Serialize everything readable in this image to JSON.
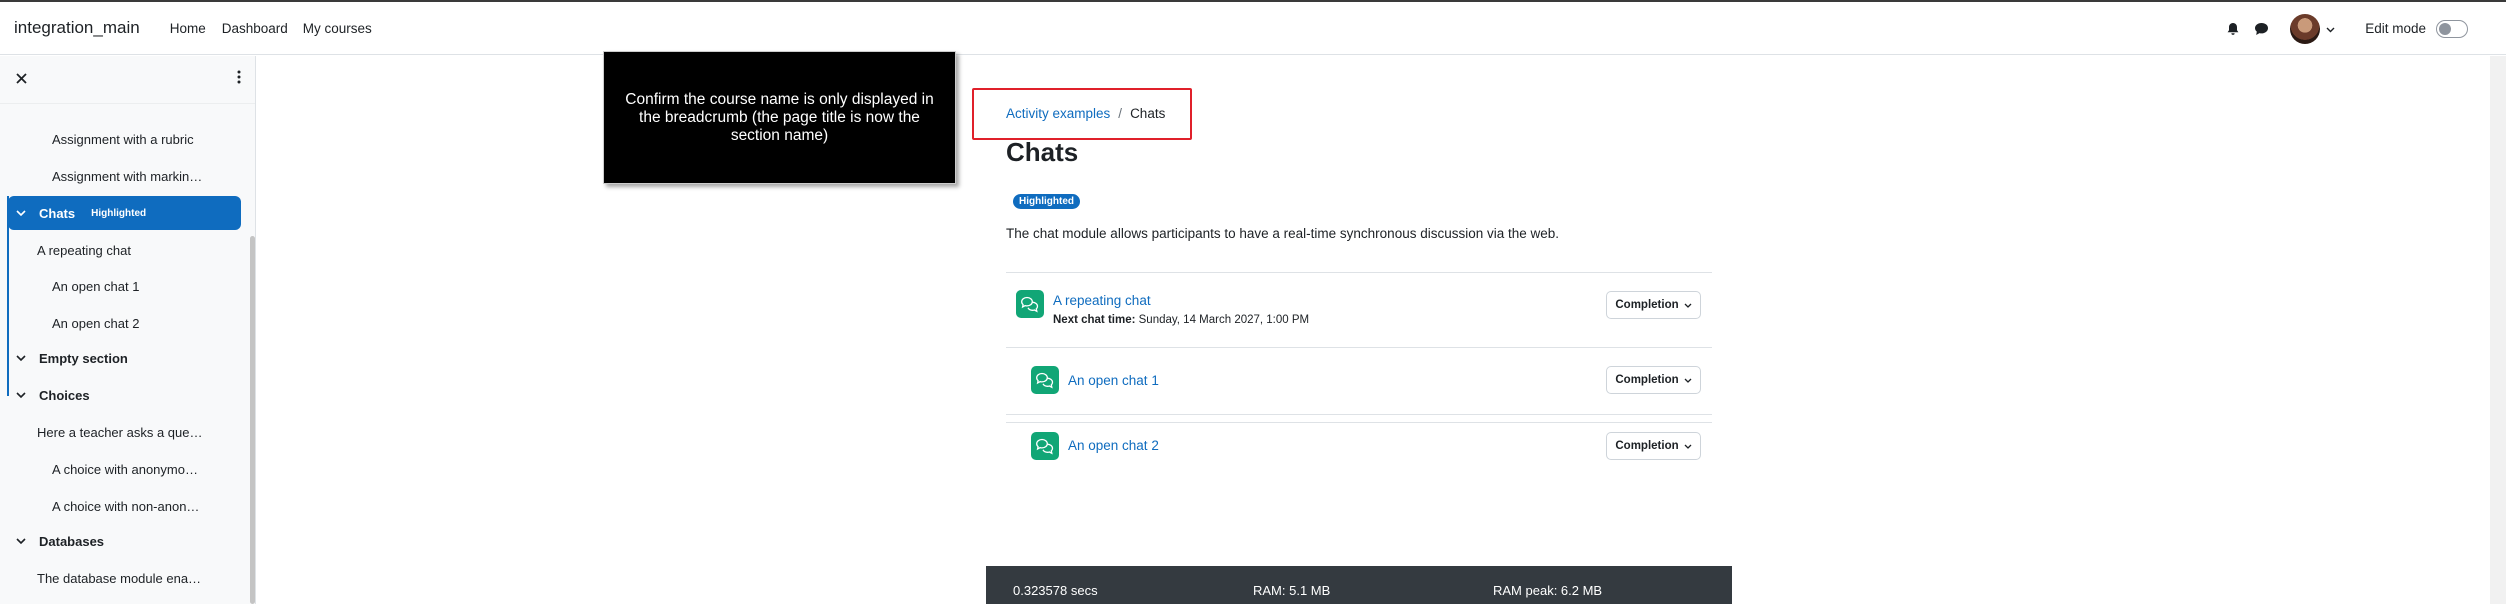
{
  "navbar": {
    "site_name": "integration_main",
    "links": [
      "Home",
      "Dashboard",
      "My courses"
    ],
    "edit_mode_label": "Edit mode"
  },
  "drawer": {
    "items": [
      {
        "type": "activity",
        "label": "Assignment with a rubric"
      },
      {
        "type": "activity",
        "label": "Assignment with markin…"
      },
      {
        "type": "section",
        "label": "Chats",
        "badge": "Highlighted",
        "active": true
      },
      {
        "type": "label",
        "label": "A repeating chat"
      },
      {
        "type": "activity",
        "label": "An open chat 1"
      },
      {
        "type": "activity",
        "label": "An open chat 2"
      },
      {
        "type": "section",
        "label": "Empty section"
      },
      {
        "type": "section",
        "label": "Choices"
      },
      {
        "type": "label",
        "label": "Here a teacher asks a que…"
      },
      {
        "type": "activity",
        "label": "A choice with anonymo…"
      },
      {
        "type": "activity",
        "label": "A choice with non-anon…"
      },
      {
        "type": "section",
        "label": "Databases"
      },
      {
        "type": "label",
        "label": "The database module ena…"
      }
    ]
  },
  "tour": {
    "text": "Confirm the course name is only displayed in the breadcrumb (the page title is now the section name)"
  },
  "main": {
    "breadcrumb": [
      "Activity examples",
      "Chats"
    ],
    "breadcrumb_separator": "/",
    "title": "Chats",
    "badge": "Highlighted",
    "summary": "The chat module allows participants to have a real-time synchronous discussion via the web.",
    "activities": [
      {
        "name": "A repeating chat",
        "meta_label": "Next chat time:",
        "meta_value": "Sunday, 14 March 2027, 1:00 PM",
        "completion": "Completion"
      },
      {
        "name": "An open chat 1",
        "completion": "Completion"
      },
      {
        "name": "An open chat 2",
        "completion": "Completion"
      }
    ]
  },
  "footer": {
    "time": "0.323578 secs",
    "ram": "RAM: 5.1 MB",
    "ram_peak": "RAM peak: 6.2 MB"
  },
  "colors": {
    "primary": "#0f6cbf",
    "activity_icon": "#11a676",
    "tour_highlight": "#e0202a",
    "footer_bg": "#343a40"
  }
}
